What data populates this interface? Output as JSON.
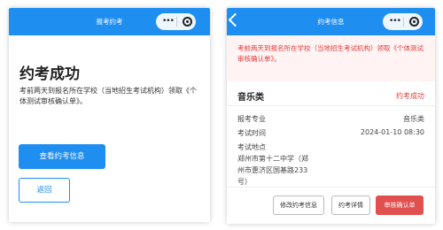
{
  "left_screen": {
    "nav_title": "报考约考",
    "title": "约考成功",
    "description": "考前两天到报名所在学校（当地招生考试机构）领取《个体测试审核确认单》。",
    "view_button": "查看约考信息",
    "back_button": "返回"
  },
  "right_screen": {
    "nav_title": "约考信息",
    "notice": "考前两天到报名所在学校（当地招生考试机构）领取《个体测试审核确认单》。",
    "category": "音乐类",
    "status": "约考成功",
    "major_label": "报考专业",
    "major_value": "音乐类",
    "time_label": "考试时间",
    "time_value": "2024-01-10 08:30",
    "place_label": "考试地点",
    "place_value": "郑州市第十二中学（郑州市惠济区国基路233号）",
    "buttons": {
      "modify": "修改约考信息",
      "detail": "约考详情",
      "print": "审核确认单"
    }
  },
  "icons": [
    "more-dots-icon",
    "target-icon",
    "back-arrow-icon"
  ],
  "colors": {
    "primary": "#1f8ef1",
    "danger": "#e23c3c",
    "notice_bg": "#fff3f3"
  }
}
